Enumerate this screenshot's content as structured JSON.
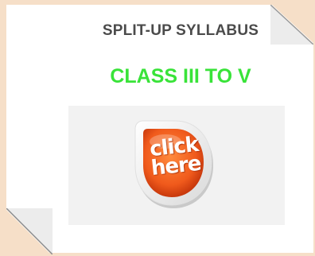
{
  "card": {
    "title": "SPLIT-UP SYLLABUS",
    "class_link": "CLASS III TO V",
    "click_button": {
      "line1": "click",
      "line2": "here"
    }
  },
  "colors": {
    "background": "#f6dfc8",
    "title": "#4b4b4b",
    "class_link": "#39e339",
    "button_orange": "#f26522"
  }
}
